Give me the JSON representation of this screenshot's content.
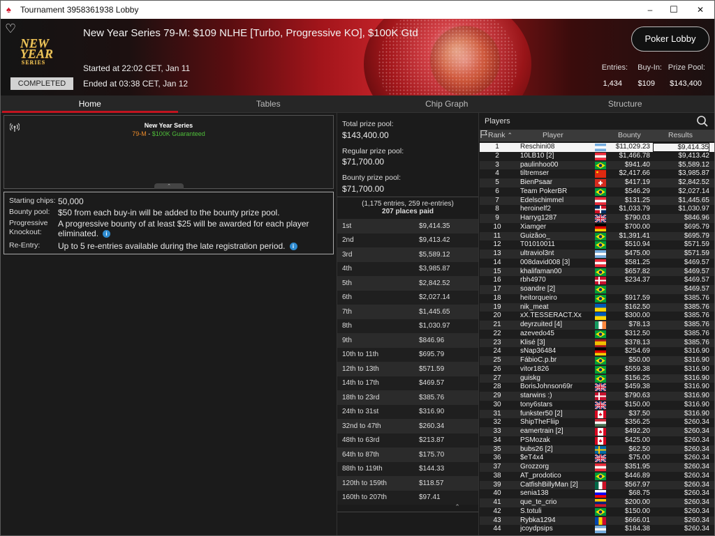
{
  "window": {
    "title": "Tournament 3958361938 Lobby",
    "minimize": "–",
    "maximize": "☐",
    "close": "✕"
  },
  "banner": {
    "logo_top": "NEW YEAR",
    "logo_bottom": "SERIES",
    "title": "New Year Series 79-M: $109 NLHE [Turbo, Progressive KO], $100K Gtd",
    "status": "COMPLETED",
    "started": "Started at 22:02 CET, Jan 11",
    "ended": "Ended at 03:38 CET, Jan 12",
    "lobby_button": "Poker Lobby",
    "entries_label": "Entries:",
    "entries_value": "1,434",
    "buyin_label": "Buy-In:",
    "buyin_value": "$109",
    "prizepool_label": "Prize Pool:",
    "prizepool_value": "$143,400"
  },
  "tabs": [
    {
      "label": "Home",
      "active": true
    },
    {
      "label": "Tables",
      "active": false
    },
    {
      "label": "Chip Graph",
      "active": false
    },
    {
      "label": "Structure",
      "active": false
    }
  ],
  "card": {
    "series": "New Year Series",
    "event_code": "79-M",
    "sep": " - ",
    "guarantee": "$100K Guaranteed",
    "accent_orange": "#e98a2a",
    "accent_green": "#4fbf3a"
  },
  "info": {
    "starting_chips_label": "Starting chips:",
    "starting_chips_value": "50,000",
    "bounty_pool_label": "Bounty pool:",
    "bounty_pool_value": "$50 from each buy-in will be added to the bounty prize pool.",
    "pko_label": "Progressive Knockout:",
    "pko_value": "A progressive bounty of at least $25 will be awarded for each player eliminated.",
    "reentry_label": "Re-Entry:",
    "reentry_value": "Up to 5 re-entries available during the late registration period.",
    "info_icon": "i"
  },
  "prize": {
    "total_label": "Total prize pool:",
    "total_value": "$143,400.00",
    "regular_label": "Regular prize pool:",
    "regular_value": "$71,700.00",
    "bounty_label": "Bounty prize pool:",
    "bounty_value": "$71,700.00",
    "entries_summary": "(1,175 entries, 259 re-entries)",
    "places_paid": "207 places paid",
    "places": [
      {
        "place": "1st",
        "amount": "$9,414.35"
      },
      {
        "place": "2nd",
        "amount": "$9,413.42"
      },
      {
        "place": "3rd",
        "amount": "$5,589.12"
      },
      {
        "place": "4th",
        "amount": "$3,985.87"
      },
      {
        "place": "5th",
        "amount": "$2,842.52"
      },
      {
        "place": "6th",
        "amount": "$2,027.14"
      },
      {
        "place": "7th",
        "amount": "$1,445.65"
      },
      {
        "place": "8th",
        "amount": "$1,030.97"
      },
      {
        "place": "9th",
        "amount": "$846.96"
      },
      {
        "place": "10th to 11th",
        "amount": "$695.79"
      },
      {
        "place": "12th to 13th",
        "amount": "$571.59"
      },
      {
        "place": "14th to 17th",
        "amount": "$469.57"
      },
      {
        "place": "18th to 23rd",
        "amount": "$385.76"
      },
      {
        "place": "24th to 31st",
        "amount": "$316.90"
      },
      {
        "place": "32nd to 47th",
        "amount": "$260.34"
      },
      {
        "place": "48th to 63rd",
        "amount": "$213.87"
      },
      {
        "place": "64th to 87th",
        "amount": "$175.70"
      },
      {
        "place": "88th to 119th",
        "amount": "$144.33"
      },
      {
        "place": "120th to 159th",
        "amount": "$118.57"
      },
      {
        "place": "160th to 207th",
        "amount": "$97.41"
      }
    ]
  },
  "players": {
    "title": "Players",
    "col_rank": "Rank",
    "col_player": "Player",
    "col_bounty": "Bounty",
    "col_results": "Results",
    "rows": [
      {
        "rank": "1",
        "name": "Reschini08",
        "flag": "ar",
        "bounty": "$11,029.23",
        "result": "$9,414.35"
      },
      {
        "rank": "2",
        "name": "10LB10 [2]",
        "flag": "at",
        "bounty": "$1,466.78",
        "result": "$9,413.42"
      },
      {
        "rank": "3",
        "name": "paulinhoo00",
        "flag": "br",
        "bounty": "$941.40",
        "result": "$5,589.12"
      },
      {
        "rank": "4",
        "name": "tiltremser",
        "flag": "cn",
        "bounty": "$2,417.66",
        "result": "$3,985.87"
      },
      {
        "rank": "5",
        "name": "BienPsaar",
        "flag": "ch",
        "bounty": "$417.19",
        "result": "$2,842.52"
      },
      {
        "rank": "6",
        "name": "Team PokerBR",
        "flag": "br",
        "bounty": "$546.29",
        "result": "$2,027.14"
      },
      {
        "rank": "7",
        "name": "Edelschimmel",
        "flag": "at",
        "bounty": "$131.25",
        "result": "$1,445.65"
      },
      {
        "rank": "8",
        "name": "heroinelf2",
        "flag": "do",
        "bounty": "$1,033.79",
        "result": "$1,030.97"
      },
      {
        "rank": "9",
        "name": "Harryg1287",
        "flag": "gb",
        "bounty": "$790.03",
        "result": "$846.96"
      },
      {
        "rank": "10",
        "name": "Xiamger",
        "flag": "de",
        "bounty": "$700.00",
        "result": "$695.79"
      },
      {
        "rank": "11",
        "name": "Guizãoo_",
        "flag": "br",
        "bounty": "$1,391.41",
        "result": "$695.79"
      },
      {
        "rank": "12",
        "name": "T01010011",
        "flag": "br",
        "bounty": "$510.94",
        "result": "$571.59"
      },
      {
        "rank": "13",
        "name": "ultraviol3nt",
        "flag": "ar",
        "bounty": "$475.00",
        "result": "$571.59"
      },
      {
        "rank": "14",
        "name": "008david008 [3]",
        "flag": "at",
        "bounty": "$581.25",
        "result": "$469.57"
      },
      {
        "rank": "15",
        "name": "khalifaman00",
        "flag": "br",
        "bounty": "$657.82",
        "result": "$469.57"
      },
      {
        "rank": "16",
        "name": "rbh4970",
        "flag": "dk",
        "bounty": "$234.37",
        "result": "$469.57"
      },
      {
        "rank": "17",
        "name": "soandre [2]",
        "flag": "br",
        "bounty": "",
        "result": "$469.57"
      },
      {
        "rank": "18",
        "name": "heitorqueiro",
        "flag": "br",
        "bounty": "$917.59",
        "result": "$385.76"
      },
      {
        "rank": "19",
        "name": "nik_meat",
        "flag": "ua",
        "bounty": "$162.50",
        "result": "$385.76"
      },
      {
        "rank": "20",
        "name": "xX.TESSERACT.Xx",
        "flag": "ua",
        "bounty": "$300.00",
        "result": "$385.76"
      },
      {
        "rank": "21",
        "name": "deyrzuited [4]",
        "flag": "ie",
        "bounty": "$78.13",
        "result": "$385.76"
      },
      {
        "rank": "22",
        "name": "azevedo45",
        "flag": "br",
        "bounty": "$312.50",
        "result": "$385.76"
      },
      {
        "rank": "23",
        "name": "Klisé [3]",
        "flag": "es",
        "bounty": "$378.13",
        "result": "$385.76"
      },
      {
        "rank": "24",
        "name": "sNap36484",
        "flag": "de",
        "bounty": "$254.69",
        "result": "$316.90"
      },
      {
        "rank": "25",
        "name": "FábioC.p.br",
        "flag": "br",
        "bounty": "$50.00",
        "result": "$316.90"
      },
      {
        "rank": "26",
        "name": "vitor1826",
        "flag": "br",
        "bounty": "$559.38",
        "result": "$316.90"
      },
      {
        "rank": "27",
        "name": "guiskg",
        "flag": "br",
        "bounty": "$156.25",
        "result": "$316.90"
      },
      {
        "rank": "28",
        "name": "BorisJohnson69r",
        "flag": "gb",
        "bounty": "$459.38",
        "result": "$316.90"
      },
      {
        "rank": "29",
        "name": "starwins :)",
        "flag": "dk",
        "bounty": "$790.63",
        "result": "$316.90"
      },
      {
        "rank": "30",
        "name": "tony6stars",
        "flag": "gb",
        "bounty": "$150.00",
        "result": "$316.90"
      },
      {
        "rank": "31",
        "name": "funkster50 [2]",
        "flag": "ca",
        "bounty": "$37.50",
        "result": "$316.90"
      },
      {
        "rank": "32",
        "name": "ShipTheFliip",
        "flag": "hu",
        "bounty": "$356.25",
        "result": "$260.34"
      },
      {
        "rank": "33",
        "name": "eamertrain [2]",
        "flag": "ca",
        "bounty": "$492.20",
        "result": "$260.34"
      },
      {
        "rank": "34",
        "name": "PSMozak",
        "flag": "ca",
        "bounty": "$425.00",
        "result": "$260.34"
      },
      {
        "rank": "35",
        "name": "bubs26 [2]",
        "flag": "se",
        "bounty": "$62.50",
        "result": "$260.34"
      },
      {
        "rank": "36",
        "name": "$eT4x4",
        "flag": "gb",
        "bounty": "$75.00",
        "result": "$260.34"
      },
      {
        "rank": "37",
        "name": "Grozzorg",
        "flag": "at",
        "bounty": "$351.95",
        "result": "$260.34"
      },
      {
        "rank": "38",
        "name": "AT_prodotico",
        "flag": "br",
        "bounty": "$446.89",
        "result": "$260.34"
      },
      {
        "rank": "39",
        "name": "CatfishBillyMan [2]",
        "flag": "mx",
        "bounty": "$567.97",
        "result": "$260.34"
      },
      {
        "rank": "40",
        "name": "senia138",
        "flag": "si",
        "bounty": "$68.75",
        "result": "$260.34"
      },
      {
        "rank": "41",
        "name": "que_te_crio",
        "flag": "ve",
        "bounty": "$200.00",
        "result": "$260.34"
      },
      {
        "rank": "42",
        "name": "S.totuli",
        "flag": "br",
        "bounty": "$150.00",
        "result": "$260.34"
      },
      {
        "rank": "43",
        "name": "Rybka1294",
        "flag": "md",
        "bounty": "$666.01",
        "result": "$260.34"
      },
      {
        "rank": "44",
        "name": "jcoydpsips",
        "flag": "ar",
        "bounty": "$184.38",
        "result": "$260.34"
      }
    ]
  },
  "colors": {
    "brand_red": "#c2141f",
    "info_blue": "#2e8bd0"
  },
  "icons": {
    "heart": "heart-icon",
    "antenna": "antenna-icon",
    "search": "search-icon",
    "flag": "flag-icon",
    "sort": "sort-ascending-icon"
  }
}
